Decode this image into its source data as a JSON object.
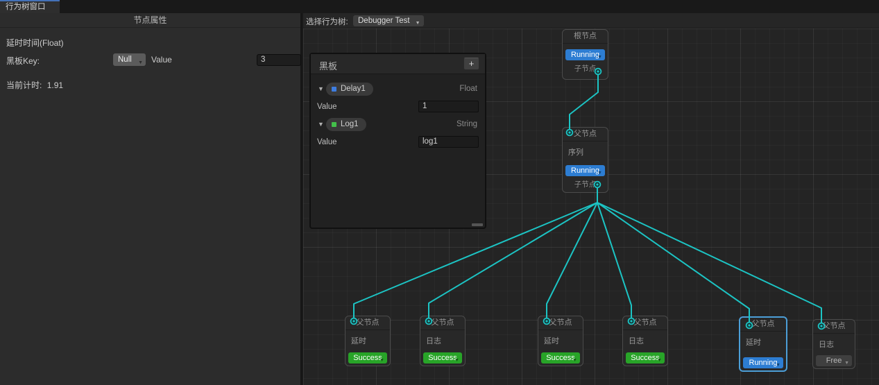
{
  "window": {
    "tab_title": "行为树窗口"
  },
  "inspector": {
    "header": "节点属性",
    "delay_time_label": "延时时间(Float)",
    "blackboard_key_label": "黑板Key:",
    "key_dropdown_value": "Null",
    "value_label": "Value",
    "value_input": "3",
    "current_timer_label": "当前计时:",
    "current_timer_value": "1.91"
  },
  "toolbar": {
    "select_tree_label": "选择行为树:",
    "selected_tree": "Debugger Test"
  },
  "blackboard": {
    "title": "黑板",
    "add_button_label": "+",
    "entries": [
      {
        "name": "Delay1",
        "type": "Float",
        "value_label": "Value",
        "value": "1",
        "swatch_color": "#3e7de0"
      },
      {
        "name": "Log1",
        "type": "String",
        "value_label": "Value",
        "value": "log1",
        "swatch_color": "#43c04a"
      }
    ]
  },
  "graph": {
    "root_node": {
      "title": "根节点",
      "status": "Running",
      "child_port_label": "子节点"
    },
    "sequence_node": {
      "title": "父节点",
      "body": "序列",
      "status": "Running",
      "child_port_label": "子节点"
    },
    "leaf_nodes": [
      {
        "title": "父节点",
        "body": "延时",
        "status": "Success"
      },
      {
        "title": "父节点",
        "body": "日志",
        "status": "Success"
      },
      {
        "title": "父节点",
        "body": "延时",
        "status": "Success"
      },
      {
        "title": "父节点",
        "body": "日志",
        "status": "Success"
      },
      {
        "title": "父节点",
        "body": "延时",
        "status": "Running"
      },
      {
        "title": "父节点",
        "body": "日志",
        "status": "Free"
      }
    ],
    "colors": {
      "edge": "#1cc4c4",
      "running": "#2d7dd2",
      "success": "#28a428",
      "free": "#3f3f3f",
      "selected_border": "#4c9fd8"
    }
  }
}
